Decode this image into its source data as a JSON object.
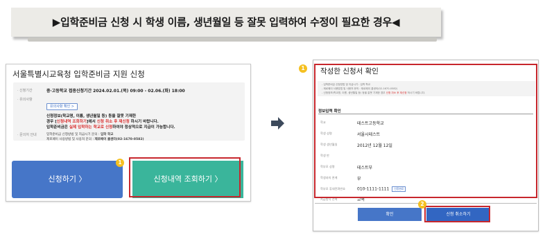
{
  "banner": {
    "title": "▶입학준비금 신청 시 학생 이름, 생년월일 등 잘못 입력하여 수정이 필요한 경우◀"
  },
  "left": {
    "title": "서울특별시교육청 입학준비금 지원 신청",
    "period_label": "· 신청기간",
    "period_value": "중·고등학교 접종신청기간 2024.02.01.(목) 09:00 - 02.06.(화) 18:00",
    "notice_label": "· 유의사항",
    "notice_button": "유의사항 확인 >",
    "note_line1": "신청정보(학교명, 이름, 생년월일 등) 등을 잘못 기재한",
    "note_line2_a": "경우 [",
    "note_line2_b": "신청내역 조회하기",
    "note_line2_c": "]에서 ",
    "note_line2_d": "신청 취소 후 재신청",
    "note_line2_e": " 하시기 바랍니다.",
    "note_line3_a": "입학준비금은 ",
    "note_line3_b": "실제 입학하는 학교로 신청",
    "note_line3_c": "하여야 정상적으로 지급이 가능합니다.",
    "contact_label": "· 문의처 안내",
    "contact_line1_a": "입학준비금 신청방법 및 지급시기 문의 : ",
    "contact_line1_b": "입학 학교",
    "contact_line2_a": "제로페이 사용방법 및 사용처 문의 : ",
    "contact_line2_b": "제로페이 콜센터(02-1670-0582)",
    "apply_button": "신청하기  〉",
    "check_button": "신청내역 조회하기  〉",
    "badge": "1"
  },
  "right": {
    "badge": "1",
    "title": "작성한 신청서 확인",
    "notes": [
      "- 입학준비금 신청방법 및 지급시기 : 입학 학교",
      "- 제로페이 사용방법 및 사용처 문의 : 제로페이 콜센터(02-1670-0582)",
      "- 신청정보(학교명, 이름, 생년월일 등) 등을 잘못 기재한 경우 신청 취소 후 재신청 하시기 바랍니다."
    ],
    "section_title": "정보입력 확인",
    "fields": [
      {
        "label": "학교",
        "value": "테스트고등학교"
      },
      {
        "label": "학생 성명",
        "value": "서울시테스트"
      },
      {
        "label": "학생 생년월일",
        "value": "2012년 12월 12일"
      },
      {
        "label": "학생 반",
        "value": ""
      },
      {
        "label": "학부모 성명",
        "value": "테스트부"
      },
      {
        "label": "학생과의 관계",
        "value": "부"
      },
      {
        "label": "학부모 휴대전화번호",
        "value": "010-1111-1111"
      },
      {
        "label": "지급방식 선택",
        "value": "교복"
      }
    ],
    "verify_label": "인증완료",
    "ok_button": "확인",
    "cancel_button": "신청 취소하기",
    "badge2": "2"
  },
  "colors": {
    "accent_blue": "#4676c8",
    "accent_green": "#3ab59b",
    "highlight_red": "#c7262c",
    "badge_yellow": "#f5c021"
  }
}
